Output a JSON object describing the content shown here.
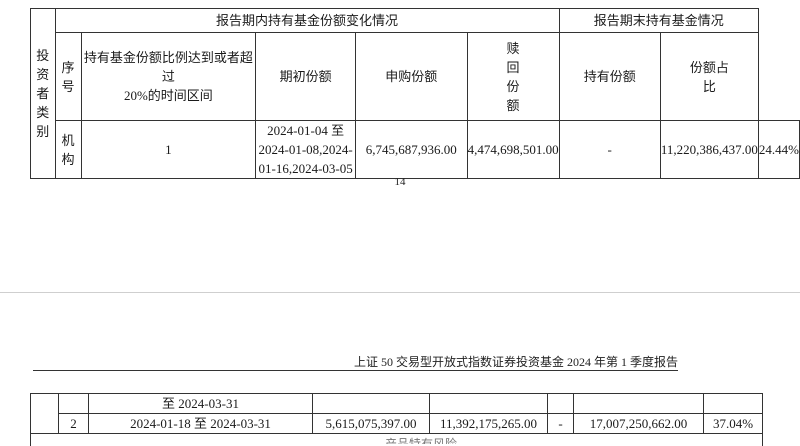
{
  "page1": {
    "table": {
      "header": {
        "investor_type": [
          "投",
          "资",
          "者",
          "类",
          "别"
        ],
        "change_group": "报告期内持有基金份额变化情况",
        "end_group": "报告期末持有基金情况",
        "seq": [
          "序",
          "号"
        ],
        "interval": [
          "持有基金份额比例达到或者超过",
          "20%的时间区间"
        ],
        "opening": "期初份额",
        "subscribe": "申购份额",
        "redeem": [
          "赎",
          "回",
          "份",
          "额"
        ],
        "holding": "持有份额",
        "ratio": [
          "份额占",
          "比"
        ]
      },
      "row": {
        "type": [
          "机",
          "构"
        ],
        "seq": "1",
        "interval": [
          "2024-01-04 至",
          "2024-01-08,2024-01-16,2024-03-05"
        ],
        "opening": "6,745,687,936.00",
        "subscribe": "4,474,698,501.00",
        "redeem": "-",
        "holding": "11,220,386,437.00",
        "ratio": "24.44%"
      }
    },
    "page_number": "14"
  },
  "page2": {
    "running_header": "上证 50 交易型开放式指数证券投资基金 2024 年第 1 季度报告",
    "table": {
      "cont_row": {
        "interval": "至 2024-03-31"
      },
      "row2": {
        "seq": "2",
        "interval": "2024-01-18 至 2024-03-31",
        "opening": "5,615,075,397.00",
        "subscribe": "11,392,175,265.00",
        "redeem": "-",
        "holding": "17,007,250,662.00",
        "ratio": "37.04%"
      }
    },
    "cutoff_text": "产品特有风险"
  }
}
